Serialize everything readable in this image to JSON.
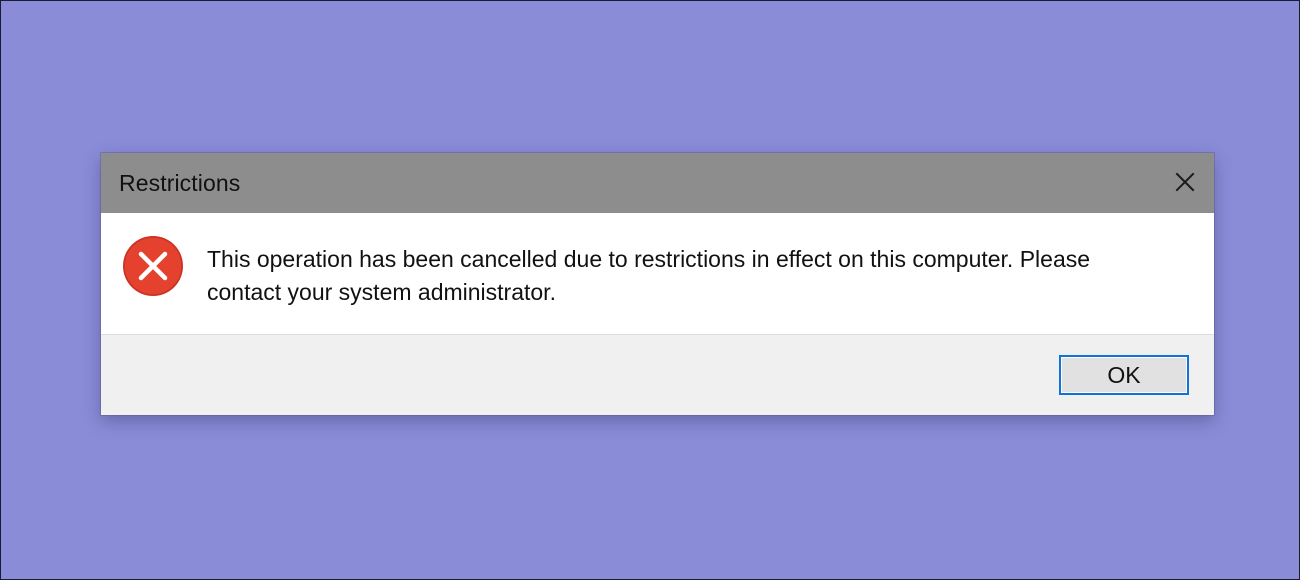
{
  "dialog": {
    "title": "Restrictions",
    "message": "This operation has been cancelled due to restrictions in effect on this computer. Please contact your system administrator.",
    "ok_label": "OK",
    "icons": {
      "close": "close-icon",
      "error": "error-icon"
    }
  },
  "colors": {
    "background": "#8a8cd8",
    "titlebar": "#8d8d8d",
    "error": "#e4412f",
    "button_focus": "#0f74d8"
  }
}
